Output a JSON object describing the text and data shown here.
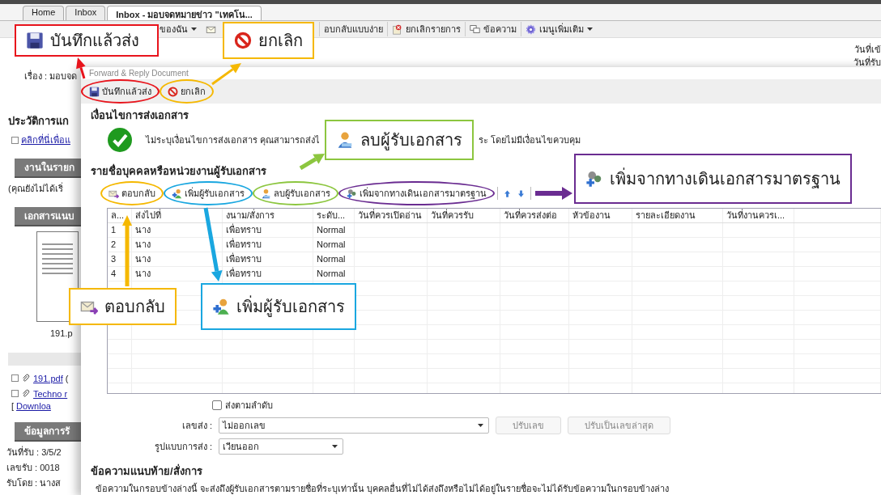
{
  "tabs": [
    {
      "label": "Home",
      "selected": false
    },
    {
      "label": "Inbox",
      "selected": false
    },
    {
      "label": "Inbox - มอบจดหมายข่าว \"เทคโน...",
      "selected": true
    }
  ],
  "toolbar": [
    {
      "text": "ของฉัน",
      "kind": "menu"
    },
    {
      "text": "อบกลับแบบง่าย",
      "kind": "button"
    },
    {
      "text": "ยกเลิกรายการ",
      "kind": "button"
    },
    {
      "text": "ข้อความ",
      "kind": "button"
    },
    {
      "text": "เมนูเพิ่มเติม",
      "kind": "menu"
    }
  ],
  "header": {
    "dates": [
      "วันที่เข้",
      "วันที่รับ"
    ]
  },
  "sidebar": {
    "subject": "เรื่อง : มอบจด",
    "history_title": "ประวัติการแก",
    "history_link": "คลิกที่นี่เพื่อแ",
    "tasks_title": "งานในรายก",
    "tasks_note": "(คุณยังไม่ได้เริ่",
    "attachments_title": "เอกสารแนบ",
    "thumbnail_caption": "191.p",
    "files": [
      {
        "link": "191.pdf",
        "rest": "("
      },
      {
        "link": "Techno r"
      }
    ],
    "download_bracket": "[",
    "download_link": "Downloa",
    "receipt_title": "ข้อมูลการรั",
    "receipt_lines": [
      "วันที่รับ : 3/5/2",
      "เลขรับ : 0018",
      "รับโดย : นางส"
    ]
  },
  "dialog": {
    "title": "Forward & Reply Document",
    "toolbar": [
      {
        "label": "บันทึกแล้วส่ง",
        "color": "#e8141c"
      },
      {
        "label": "ยกเลิก",
        "color": "#f5b800"
      }
    ],
    "condition_title": "เงื่อนไขการส่งเอกสาร",
    "condition_text_before": "ไม่ระบุเงื่อนไขการส่งเอกสาร คุณสามารถส่งไ",
    "condition_text_after": "ระ โดยไม่มีเงื่อนไขควบคุม",
    "recipients_title": "รายชื่อบุคคลหรือหน่วยงานผู้รับเอกสาร",
    "recipients_toolbar": [
      {
        "label": "ตอบกลับ",
        "color": "#f5b800"
      },
      {
        "label": "เพิ่มผู้รับเอกสาร",
        "color": "#1aa7e0"
      },
      {
        "label": "ลบผู้รับเอกสาร",
        "color": "#8cc63f"
      },
      {
        "label": "เพิ่มจากทางเดินเอกสารมาตรฐาน",
        "color": "#6a2c91"
      }
    ],
    "columns": [
      "ล...",
      "ส่งไปที่",
      "งนาม/สั่งการ",
      "ระดับ...",
      "วันที่ควรเปิดอ่าน",
      "วันที่ควรรับ",
      "วันที่ควรส่งต่อ",
      "หัวข้องาน",
      "รายละเอียดงาน",
      "วันที่งานควรเ..."
    ],
    "rows": [
      [
        "1",
        "นาง",
        "เพื่อทราบ",
        "Normal"
      ],
      [
        "2",
        "นาง",
        "เพื่อทราบ",
        "Normal"
      ],
      [
        "3",
        "นาง",
        "เพื่อทราบ",
        "Normal"
      ],
      [
        "4",
        "นาง",
        "เพื่อทราบ",
        "Normal"
      ]
    ],
    "send_in_order": {
      "label": "ส่งตามลำดับ",
      "checked": false
    },
    "number": {
      "label": "เลขส่ง :",
      "value": "ไม่ออกเลข",
      "buttons": [
        {
          "label": "ปรับเลข",
          "disabled": true
        },
        {
          "label": "ปรับเป็นเลขล่าสุด",
          "disabled": true
        }
      ]
    },
    "format": {
      "label": "รูปแบบการส่ง :",
      "value": "เวียนออก"
    },
    "message_title": "ข้อความแนบท้าย/สั่งการ",
    "message_text": "ข้อความในกรอบข้างล่างนี้ จะส่งถึงผู้รับเอกสารตามรายชื่อที่ระบุเท่านั้น บุคคลอื่นที่ไม่ได้ส่งถึงหรือไม่ได้อยู่ในรายชื่อจะไม่ได้รับข้อความในกรอบข้างล่าง"
  },
  "annotations": [
    {
      "text": "บันทึกแล้วส่ง",
      "color": "#e8141c"
    },
    {
      "text": "ยกเลิก",
      "color": "#f5b800"
    },
    {
      "text": "ลบผู้รับเอกสาร",
      "color": "#8cc63f"
    },
    {
      "text": "เพิ่มจากทางเดินเอกสารมาตรฐาน",
      "color": "#6a2c91"
    },
    {
      "text": "ตอบกลับ",
      "color": "#f5b800"
    },
    {
      "text": "เพิ่มผู้รับเอกสาร",
      "color": "#1aa7e0"
    }
  ]
}
